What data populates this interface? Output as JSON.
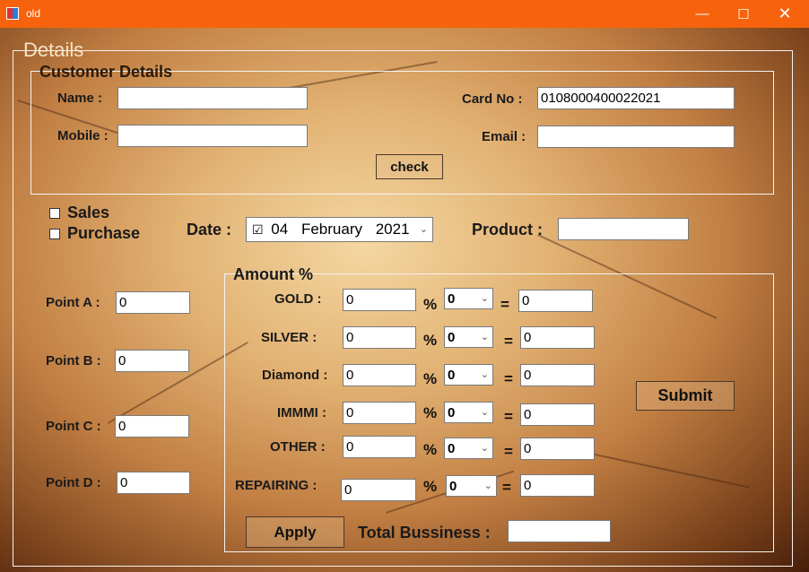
{
  "window": {
    "title": "old"
  },
  "details": {
    "legend": "Details"
  },
  "customer": {
    "legend": "Customer Details",
    "name_label": "Name :",
    "name_value": "",
    "mobile_label": "Mobile :",
    "mobile_value": "",
    "card_label": "Card No :",
    "card_value": "0108000400022021",
    "email_label": "Email :",
    "email_value": "",
    "check_button": "check"
  },
  "transaction": {
    "sales_label": "Sales",
    "purchase_label": "Purchase",
    "date_label": "Date :",
    "date_day": "04",
    "date_month": "February",
    "date_year": "2021",
    "product_label": "Product :",
    "product_value": ""
  },
  "points": [
    {
      "label": "Point A :",
      "value": "0"
    },
    {
      "label": "Point B :",
      "value": "0"
    },
    {
      "label": "Point C :",
      "value": "0"
    },
    {
      "label": "Point D :",
      "value": "0"
    }
  ],
  "amount": {
    "legend": "Amount  %",
    "percent_sign": "%",
    "equals_sign": "=",
    "rows": [
      {
        "label": "GOLD :",
        "amount": "0",
        "percent": "0",
        "result": "0"
      },
      {
        "label": "SILVER :",
        "amount": "0",
        "percent": "0",
        "result": "0"
      },
      {
        "label": "Diamond :",
        "amount": "0",
        "percent": "0",
        "result": "0"
      },
      {
        "label": "IMMMI :",
        "amount": "0",
        "percent": "0",
        "result": "0"
      },
      {
        "label": "OTHER :",
        "amount": "0",
        "percent": "0",
        "result": "0"
      },
      {
        "label": "REPAIRING :",
        "amount": "0",
        "percent": "0",
        "result": "0"
      }
    ],
    "submit_button": "Submit",
    "apply_button": "Apply",
    "total_label": "Total Bussiness :",
    "total_value": ""
  },
  "colors": {
    "titlebar": "#f7630c",
    "background": "#d9a56a"
  }
}
